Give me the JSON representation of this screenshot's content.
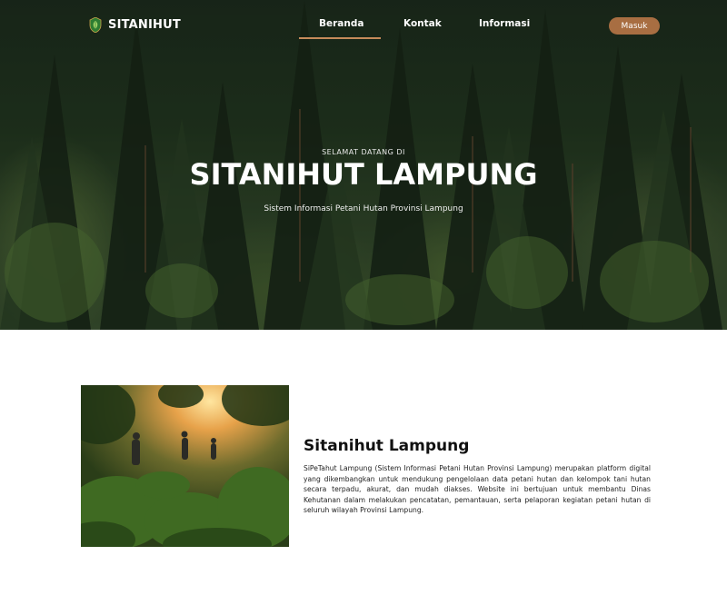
{
  "brand": {
    "name": "SITANIHUT",
    "logo_icon": "leaf-emblem-icon"
  },
  "nav": {
    "items": [
      {
        "label": "Beranda",
        "active": true
      },
      {
        "label": "Kontak",
        "active": false
      },
      {
        "label": "Informasi",
        "active": false
      }
    ],
    "login_label": "Masuk"
  },
  "hero": {
    "kicker": "SELAMAT DATANG DI",
    "title": "SITANIHUT LAMPUNG",
    "subtitle": "Sistem Informasi Petani Hutan Provinsi Lampung"
  },
  "about": {
    "title": "Sitanihut Lampung",
    "description": "SiPeTahut Lampung (Sistem Informasi Petani Hutan Provinsi Lampung) merupakan platform digital yang dikembangkan untuk mendukung pengelolaan data petani hutan dan kelompok tani hutan secara terpadu, akurat, dan mudah diakses. Website ini bertujuan untuk membantu Dinas Kehutanan dalam melakukan pencatatan, pemantauan, serta pelaporan kegiatan petani hutan di seluruh wilayah Provinsi Lampung."
  },
  "colors": {
    "accent": "#a86e42",
    "underline": "#c58a5a",
    "hero_dark": "#1b2a1d"
  }
}
